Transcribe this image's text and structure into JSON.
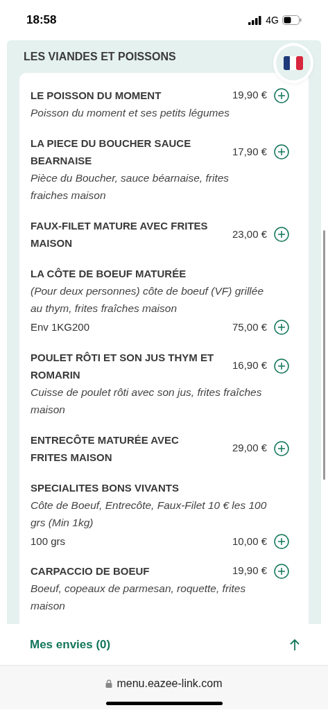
{
  "status_bar": {
    "time": "18:58",
    "network": "4G"
  },
  "section": {
    "title": "LES VIANDES ET POISSONS",
    "items": [
      {
        "name": "LE POISSON DU MOMENT",
        "price": "19,90 €",
        "description": "Poisson du moment et ses petits légumes"
      },
      {
        "name": "LA PIECE DU BOUCHER SAUCE BEARNAISE",
        "price": "17,90 €",
        "description": "Pièce du Boucher, sauce béarnaise, frites fraiches maison"
      },
      {
        "name": "FAUX-FILET MATURE AVEC FRITES MAISON",
        "price": "23,00 €"
      },
      {
        "name": "LA CÔTE DE BOEUF MATURÉE",
        "description": "(Pour deux personnes) côte de boeuf (VF) grillée au thym, frites fraîches maison",
        "variant": {
          "label": "Env 1KG200",
          "price": "75,00 €"
        }
      },
      {
        "name": "POULET RÔTI ET SON JUS THYM ET ROMARIN",
        "price": "16,90 €",
        "description": "Cuisse de poulet rôti avec son jus, frites fraîches maison"
      },
      {
        "name": "ENTRECÔTE MATURÉE AVEC FRITES MAISON",
        "price": "29,00 €"
      },
      {
        "name": "SPECIALITES BONS VIVANTS",
        "description": "Côte de Boeuf, Entrecôte, Faux-Filet 10 € les 100 grs (Min 1kg)",
        "variant": {
          "label": "100 grs",
          "price": "10,00 €"
        }
      },
      {
        "name": "CARPACCIO DE BOEUF",
        "price": "19,90 €",
        "description": "Boeuf, copeaux de parmesan, roquette, frites maison"
      }
    ]
  },
  "wishlist": {
    "label": "Mes envies (0)"
  },
  "browser": {
    "url": "menu.eazee-link.com"
  }
}
